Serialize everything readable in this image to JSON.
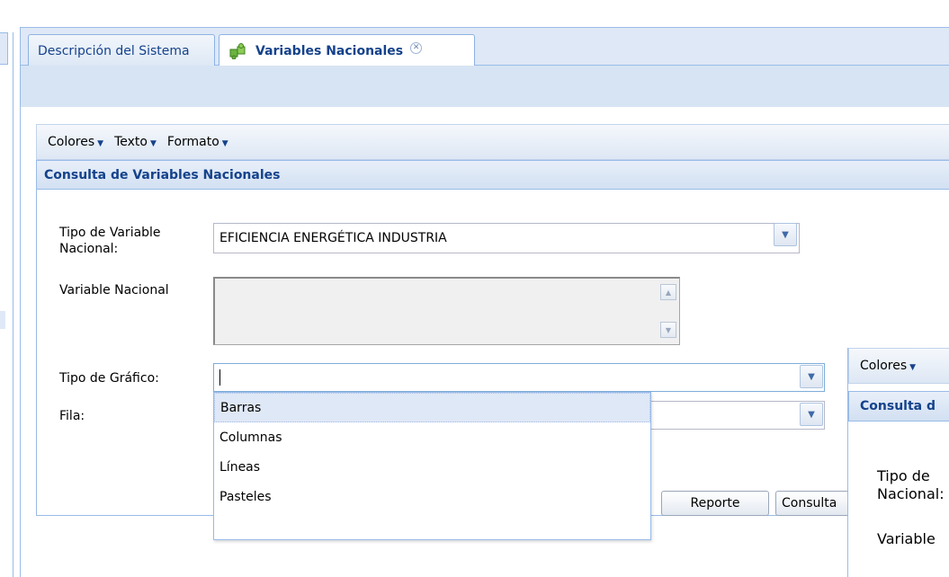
{
  "tabs": [
    {
      "label": "Descripción del Sistema",
      "active": false
    },
    {
      "label": "Variables Nacionales",
      "active": true,
      "icon": "puzzle-icon"
    }
  ],
  "menu": {
    "colores": "Colores",
    "texto": "Texto",
    "formato": "Formato"
  },
  "panel": {
    "title": "Consulta de Variables Nacionales"
  },
  "form": {
    "tipo_variable_label": "Tipo de Variable Nacional:",
    "tipo_variable_value": "EFICIENCIA ENERGÉTICA INDUSTRIA",
    "variable_nacional_label": "Variable Nacional",
    "tipo_grafico_label": "Tipo de Gráfico:",
    "tipo_grafico_value": "",
    "fila_label": "Fila:"
  },
  "dropdown": {
    "options": [
      "Barras",
      "Columnas",
      "Líneas",
      "Pasteles"
    ],
    "highlighted": "Barras"
  },
  "buttons": {
    "reporte": "Reporte",
    "consulta": "Consulta"
  },
  "second_window": {
    "menu_colores": "Colores",
    "panel_title": "Consulta d",
    "tipo_label": "Tipo de",
    "tipo_label_2": "Nacional:",
    "variable_label": "Variable"
  },
  "colors": {
    "accent": "#15428b",
    "border": "#99bbe8",
    "header_bg": "#dfe8f6"
  }
}
